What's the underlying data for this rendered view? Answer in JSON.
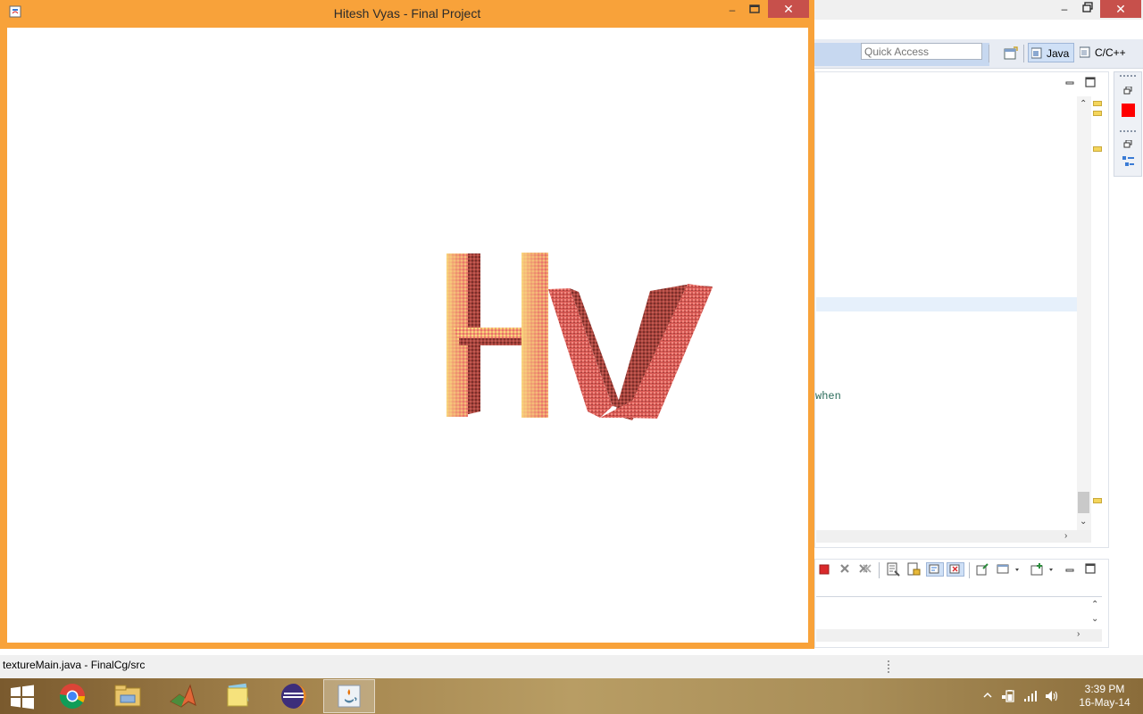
{
  "java_window": {
    "title": "Hitesh Vyas - Final Project",
    "close_glyph": "✕",
    "min_glyph": "–",
    "frame_color": "#f8a23a"
  },
  "scene": {
    "letters": [
      "H",
      "V"
    ],
    "palette": {
      "light": "#f9d77e",
      "mid": "#e8706a",
      "dark": "#7a2f2a"
    }
  },
  "eclipse": {
    "quick_access_placeholder": "Quick Access",
    "perspectives": [
      {
        "label": "Java",
        "active": true
      },
      {
        "label": "C/C++",
        "active": false
      }
    ],
    "editor_fragment": "when",
    "status_text": "textureMain.java - FinalCg/src",
    "close_glyph": "✕"
  },
  "taskbar": {
    "apps": [
      {
        "icon": "chrome-icon"
      },
      {
        "icon": "file-explorer-icon"
      },
      {
        "icon": "matlab-icon"
      },
      {
        "icon": "sticky-notes-icon"
      },
      {
        "icon": "eclipse-icon"
      },
      {
        "icon": "java-icon",
        "active": true
      }
    ],
    "time": "3:39 PM",
    "date": "16-May-14"
  }
}
